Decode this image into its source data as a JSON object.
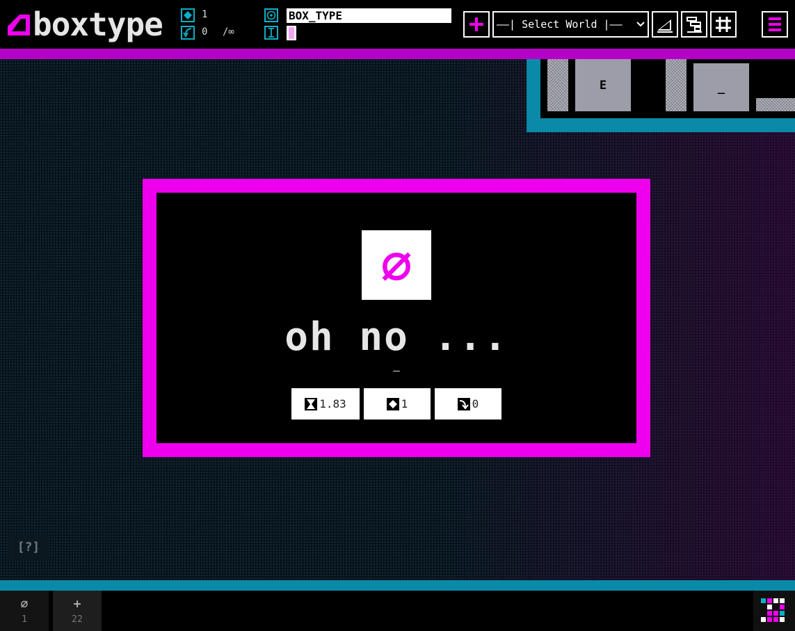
{
  "app": {
    "logo_text": "boxtype",
    "colors": {
      "magenta": "#ee00ee",
      "teal": "#0a8aa8",
      "cyan": "#0ab0c8"
    }
  },
  "header": {
    "boxes_count": "1",
    "moves_count": "0",
    "moves_limit": "/∞",
    "world_name_value": "BOX_TYPE",
    "text_input_value": "",
    "icons": {
      "boxes": "diamond-icon",
      "moves": "undo-arrow-icon",
      "target": "target-icon",
      "text": "text-cursor-icon"
    },
    "add_button": "plus-icon",
    "world_select": {
      "selected": "——| Select World |——"
    },
    "tools": [
      "ramp-icon",
      "align-icon",
      "grid-icon",
      "menu-icon"
    ]
  },
  "world_preview": {
    "tiles": [
      "E",
      "_"
    ]
  },
  "dialog": {
    "icon": "null-set-icon",
    "icon_glyph": "∅",
    "title": "oh no ...",
    "subtitle": "—",
    "stats": [
      {
        "icon": "hourglass-icon",
        "value": "1.83"
      },
      {
        "icon": "diamond-icon",
        "value": "1"
      },
      {
        "icon": "return-arrow-icon",
        "value": "0"
      }
    ]
  },
  "help_label": "[?]",
  "footer": {
    "tabs": [
      {
        "icon": "∅",
        "count": "1"
      },
      {
        "icon": "+",
        "count": "22"
      }
    ]
  }
}
